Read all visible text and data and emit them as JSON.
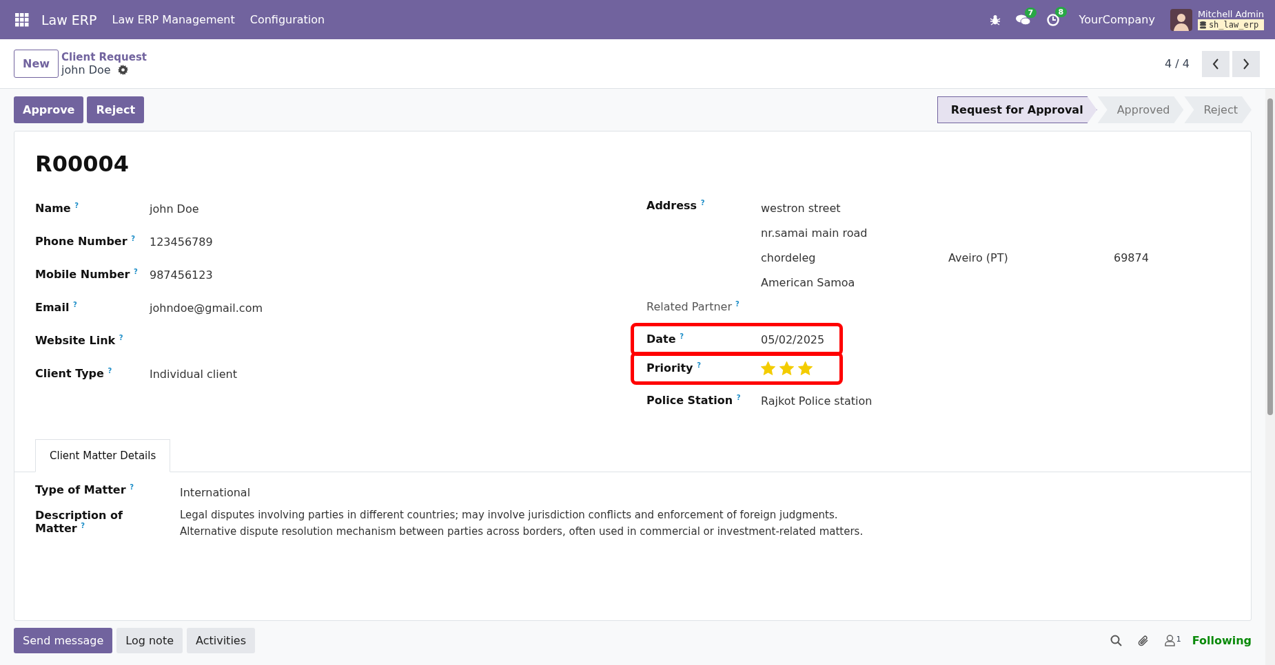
{
  "navbar": {
    "app_name": "Law ERP",
    "menus": [
      "Law ERP Management",
      "Configuration"
    ],
    "messages_count": "7",
    "activities_count": "8",
    "company": "YourCompany",
    "user": "Mitchell Admin",
    "database": "sh_law_erp"
  },
  "control_panel": {
    "new_button": "New",
    "breadcrumb": "Client Request",
    "record_name": "john Doe",
    "pager": "4 / 4"
  },
  "actions": [
    "Approve",
    "Reject"
  ],
  "stages": [
    {
      "label": "Request for Approval",
      "selected": true
    },
    {
      "label": "Approved",
      "selected": false
    },
    {
      "label": "Reject",
      "selected": false
    }
  ],
  "reference": "R00004",
  "left_fields": [
    {
      "label": "Name $^{?}$",
      "value": "john Doe"
    },
    {
      "label": "Phone Number $^{?}$",
      "value": "123456789"
    },
    {
      "label": "Mobile Number $^{?}$",
      "value": "987456123"
    },
    {
      "label": "Email $^{?}$",
      "value": "johndoe@gmail.com"
    },
    {
      "label": "Website Link $^{?}$"
    },
    {
      "label": "Client Type $^{?}$",
      "value": "Individual client"
    }
  ],
  "address": {
    "label": "Address $^{?}$",
    "street": "westron street",
    "street2": "nr.samai main road",
    "city": "chordeleg",
    "state": "Aveiro (PT)",
    "zip": "69874",
    "country": "American Samoa"
  },
  "right_fields": [
    {
      "kind": "text",
      "label": "Related Partner $^{?}$",
      "muted": true
    },
    {
      "kind": "text",
      "label": "Date $^{?}$",
      "value": "05/02/2025",
      "highlighted": true
    },
    {
      "kind": "stars",
      "label": "Priority $^{?}$",
      "stars": 3,
      "highlighted": true
    },
    {
      "kind": "text",
      "label": "Police Station $^{?}$",
      "value": "Rajkot Police station"
    }
  ],
  "tabs": [
    {
      "label": "Client Matter Details",
      "selected": true
    }
  ],
  "matter": {
    "type_label": "Type of Matter $^{?}$",
    "type_value": "International",
    "description_label": "Description of Matter $^{?}$",
    "description_lines": [
      "Legal disputes involving parties in different countries; may involve jurisdiction conflicts and enforcement of foreign judgments.",
      "Alternative dispute resolution mechanism between parties across borders, often used in commercial or investment-related matters."
    ]
  },
  "chatter": {
    "buttons": [
      "Send message",
      "Log note",
      "Activities"
    ],
    "followers_count": "1",
    "follow_label": "Following"
  }
}
